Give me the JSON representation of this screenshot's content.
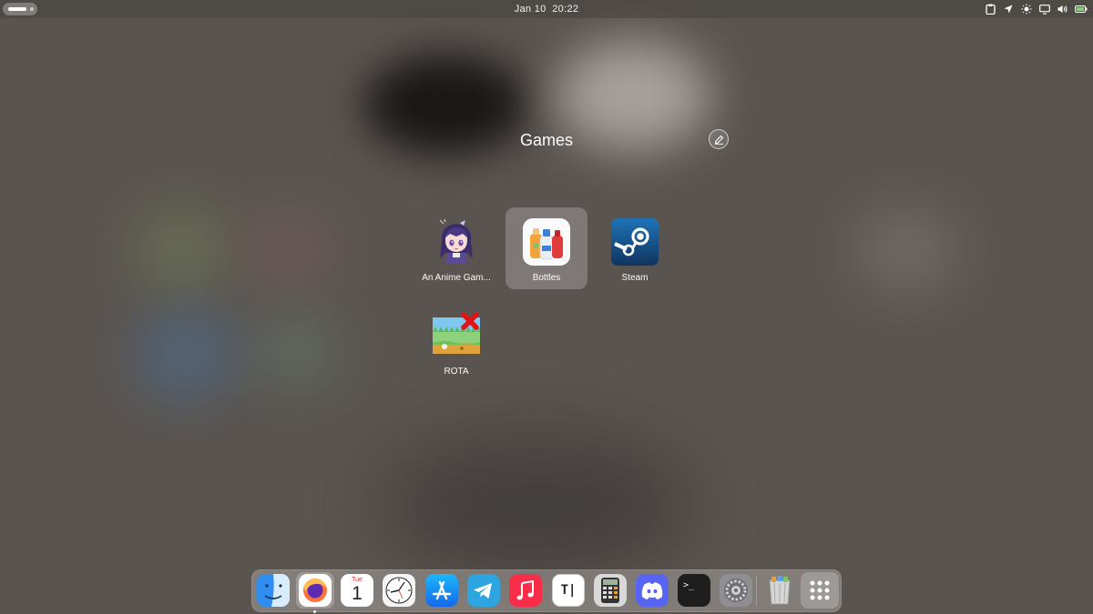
{
  "top_bar": {
    "date": "Jan 10",
    "time": "20:22",
    "tray_icons": [
      "clipboard-icon",
      "location-icon",
      "brightness-icon",
      "display-icon",
      "volume-icon",
      "battery-icon"
    ]
  },
  "folder": {
    "title": "Games",
    "apps": [
      {
        "label": "An Anime Gam...",
        "icon": "anime-game-launcher-icon"
      },
      {
        "label": "Bottles",
        "icon": "bottles-icon",
        "selected": true
      },
      {
        "label": "Steam",
        "icon": "steam-icon"
      },
      {
        "label": "ROTA",
        "icon": "rota-icon"
      }
    ]
  },
  "dock": {
    "apps": [
      {
        "name": "finder",
        "icon": "finder-icon"
      },
      {
        "name": "firefox",
        "icon": "firefox-icon",
        "running": true
      },
      {
        "name": "calendar",
        "icon": "calendar-icon",
        "month": "Tue",
        "day": "1"
      },
      {
        "name": "clock",
        "icon": "clock-icon"
      },
      {
        "name": "app-store",
        "icon": "app-store-icon"
      },
      {
        "name": "telegram",
        "icon": "telegram-icon"
      },
      {
        "name": "music",
        "icon": "music-icon"
      },
      {
        "name": "text-editor",
        "icon": "text-editor-icon",
        "glyph": "T|"
      },
      {
        "name": "calculator",
        "icon": "calculator-icon"
      },
      {
        "name": "discord",
        "icon": "discord-icon"
      },
      {
        "name": "terminal",
        "icon": "terminal-icon",
        "glyph": ">_"
      },
      {
        "name": "settings",
        "icon": "settings-icon"
      },
      {
        "name": "trash",
        "icon": "trash-icon"
      },
      {
        "name": "app-grid",
        "icon": "app-grid-icon"
      }
    ]
  },
  "colors": {
    "background": "#5a5450",
    "steam_blue": "#1b5f9e",
    "telegram": "#2ca5e0",
    "music": "#fa2d48",
    "discord": "#5865f2"
  }
}
